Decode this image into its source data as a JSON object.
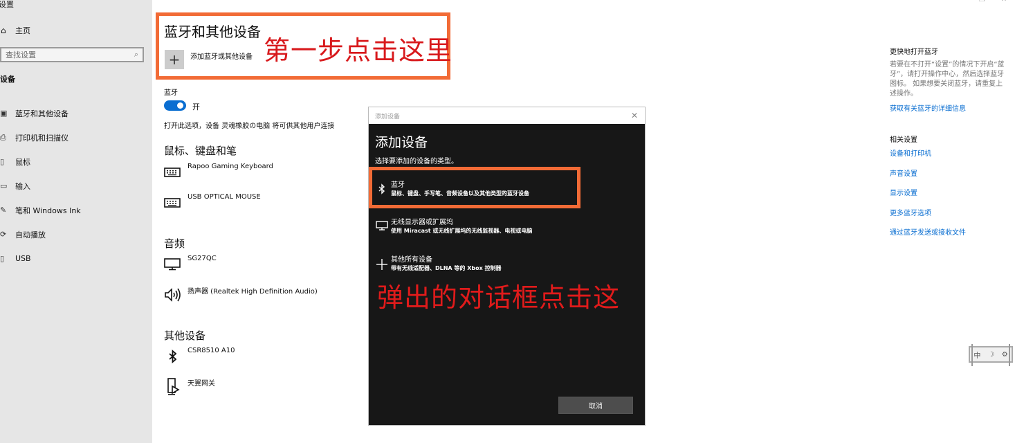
{
  "window": {
    "title": "设置",
    "controls": {
      "minimize": "–",
      "maximize": "❐",
      "close": "✕"
    }
  },
  "sidebar": {
    "home_label": "主页",
    "search_placeholder": "查找设置",
    "section_label": "设备",
    "items": [
      {
        "label": "蓝牙和其他设备",
        "icon": "bluetooth-devices-icon",
        "glyph": "▣"
      },
      {
        "label": "打印机和扫描仪",
        "icon": "printer-icon",
        "glyph": "⎙"
      },
      {
        "label": "鼠标",
        "icon": "mouse-icon",
        "glyph": "▯"
      },
      {
        "label": "输入",
        "icon": "keyboard-icon",
        "glyph": "▭"
      },
      {
        "label": "笔和 Windows Ink",
        "icon": "pen-icon",
        "glyph": "✎"
      },
      {
        "label": "自动播放",
        "icon": "autoplay-icon",
        "glyph": "⟳"
      },
      {
        "label": "USB",
        "icon": "usb-icon",
        "glyph": "▯"
      }
    ]
  },
  "main": {
    "title": "蓝牙和其他设备",
    "add_device_label": "添加蓝牙或其他设备",
    "bluetooth_label": "蓝牙",
    "bluetooth_on": true,
    "toggle_text": "开",
    "discoverable_text": "打开此选项，设备 灵魂橡胶の电脑 将可供其他用户连接",
    "groups": [
      {
        "title": "鼠标、键盘和笔",
        "devices": [
          {
            "name": "Rapoo Gaming Keyboard",
            "icon": "keyboard-icon"
          },
          {
            "name": "USB OPTICAL MOUSE",
            "icon": "keyboard-icon"
          }
        ]
      },
      {
        "title": "音频",
        "devices": [
          {
            "name": "SG27QC",
            "icon": "monitor-icon"
          },
          {
            "name": "扬声器 (Realtek High Definition Audio)",
            "icon": "speaker-icon"
          }
        ]
      },
      {
        "title": "其他设备",
        "devices": [
          {
            "name": "CSR8510 A10",
            "icon": "bluetooth-icon"
          },
          {
            "name": "天翼网关",
            "icon": "media-device-icon"
          }
        ]
      }
    ]
  },
  "annotations": {
    "step1": "第一步点击这里",
    "step2": "弹出的对话框点击这",
    "highlight_color": "#f26b36",
    "text_color": "#d8191c"
  },
  "right_panel": {
    "quick_title": "更快地打开蓝牙",
    "quick_desc": "若要在不打开“设置”的情况下开启“蓝牙”，请打开操作中心，然后选择蓝牙图标。 如果想要关闭蓝牙，请重复上述操作。",
    "quick_link": "获取有关蓝牙的详细信息",
    "related_title": "相关设置",
    "related_links": [
      "设备和打印机",
      "声音设置",
      "显示设置",
      "更多蓝牙选项",
      "通过蓝牙发送或接收文件"
    ]
  },
  "dialog": {
    "window_title": "添加设备",
    "heading": "添加设备",
    "subtitle": "选择要添加的设备的类型。",
    "options": [
      {
        "title": "蓝牙",
        "desc": "鼠标、键盘、手写笔、音频设备以及其他类型的蓝牙设备",
        "icon": "bluetooth-icon"
      },
      {
        "title": "无线显示器或扩展坞",
        "desc": "使用 Miracast 或无线扩展坞的无线监视器、电视或电脑",
        "icon": "monitor-icon"
      },
      {
        "title": "其他所有设备",
        "desc": "带有无线适配器、DLNA 等的 Xbox 控制器",
        "icon": "plus-icon"
      }
    ],
    "cancel_label": "取消"
  },
  "ime_bar": {
    "mode": "中",
    "items": [
      "中",
      "☽",
      "⚙"
    ]
  },
  "colors": {
    "accent": "#0a6ed1",
    "sidebar_bg": "#e6e6e6",
    "dialog_bg": "#171717"
  }
}
